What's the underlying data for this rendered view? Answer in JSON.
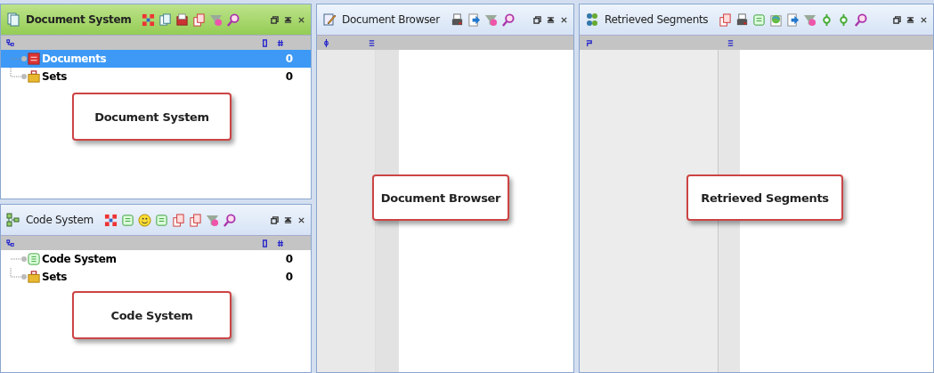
{
  "panels": [
    {
      "title": "Document System",
      "active": true,
      "tree": [
        {
          "label": "Documents",
          "count": "0",
          "kind": "documents",
          "selected": true
        },
        {
          "label": "Sets",
          "count": "0",
          "kind": "sets",
          "selected": false
        }
      ],
      "callout": "Document System"
    },
    {
      "title": "Code System",
      "active": false,
      "tree": [
        {
          "label": "Code System",
          "count": "0",
          "kind": "codes",
          "selected": false
        },
        {
          "label": "Sets",
          "count": "0",
          "kind": "sets",
          "selected": false
        }
      ],
      "callout": "Code System"
    },
    {
      "title": "Document Browser",
      "active": false,
      "callout": "Document Browser"
    },
    {
      "title": "Retrieved Segments",
      "active": false,
      "callout": "Retrieved Segments"
    }
  ]
}
